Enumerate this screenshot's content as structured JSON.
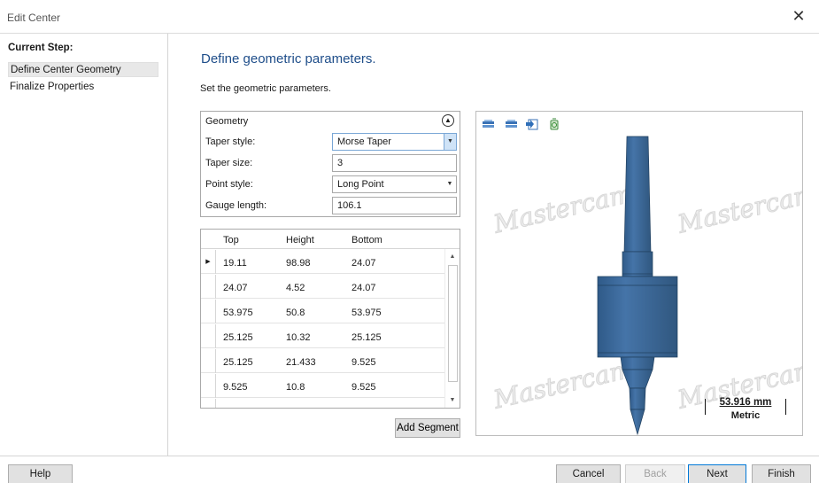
{
  "window": {
    "title": "Edit Center",
    "close_symbol": "✕"
  },
  "sidebar": {
    "heading": "Current Step:",
    "items": [
      {
        "label": "Define Center Geometry",
        "selected": true
      },
      {
        "label": "Finalize Properties",
        "selected": false
      }
    ]
  },
  "main": {
    "heading": "Define geometric parameters.",
    "subtitle": "Set the geometric parameters."
  },
  "geometry": {
    "title": "Geometry",
    "fields": [
      {
        "label": "Taper style:",
        "value": "Morse Taper",
        "type": "dropdown"
      },
      {
        "label": "Taper size:",
        "value": "3",
        "type": "text"
      },
      {
        "label": "Point style:",
        "value": "Long Point",
        "type": "dropdown"
      },
      {
        "label": "Gauge length:",
        "value": "106.1",
        "type": "text"
      }
    ]
  },
  "segments": {
    "columns": [
      "Top",
      "Height",
      "Bottom"
    ],
    "rows": [
      [
        "19.11",
        "98.98",
        "24.07"
      ],
      [
        "24.07",
        "4.52",
        "24.07"
      ],
      [
        "53.975",
        "50.8",
        "53.975"
      ],
      [
        "25.125",
        "10.32",
        "25.125"
      ],
      [
        "25.125",
        "21.433",
        "9.525"
      ],
      [
        "9.525",
        "10.8",
        "9.525"
      ]
    ],
    "add_label": "Add Segment"
  },
  "viewer": {
    "watermark": "Mastercam.",
    "tool_icons": [
      "view-fit-icon",
      "view-shade-icon",
      "view-rotate-icon",
      "view-recycle-icon"
    ],
    "scale_value": "53.916 mm",
    "scale_unit": "Metric",
    "model_color": "#3d6899"
  },
  "footer": {
    "help": "Help",
    "cancel": "Cancel",
    "back": "Back",
    "next": "Next",
    "finish": "Finish"
  },
  "colors": {
    "accent": "#0078d7",
    "heading": "#1f4e8a",
    "selection": "#cfe3f7"
  }
}
